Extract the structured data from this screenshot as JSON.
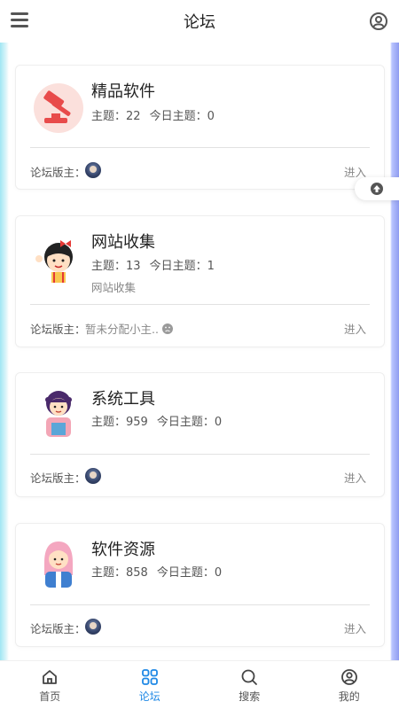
{
  "header": {
    "title": "论坛"
  },
  "forums": [
    {
      "name": "精品软件",
      "topics_label": "主题：",
      "topics": "22",
      "today_label": "今日主题：",
      "today": "0",
      "desc": "",
      "mod_label": "论坛版主：",
      "mod_none": "",
      "enter": "进入",
      "icon": "gavel-icon"
    },
    {
      "name": "网站收集",
      "topics_label": "主题：",
      "topics": "13",
      "today_label": "今日主题：",
      "today": "1",
      "desc": "网站收集",
      "mod_label": "论坛版主：",
      "mod_none": "暂未分配小主..",
      "enter": "进入",
      "icon": "girl-cartoon-icon"
    },
    {
      "name": "系统工具",
      "topics_label": "主题：",
      "topics": "959",
      "today_label": "今日主题：",
      "today": "0",
      "desc": "",
      "mod_label": "论坛版主：",
      "mod_none": "",
      "enter": "进入",
      "icon": "woman-overalls-icon"
    },
    {
      "name": "软件资源",
      "topics_label": "主题：",
      "topics": "858",
      "today_label": "今日主题：",
      "today": "0",
      "desc": "",
      "mod_label": "论坛版主：",
      "mod_none": "",
      "enter": "进入",
      "icon": "pink-hair-woman-icon"
    }
  ],
  "nav": [
    {
      "label": "首页",
      "icon": "home-icon",
      "active": false
    },
    {
      "label": "论坛",
      "icon": "grid-icon",
      "active": true
    },
    {
      "label": "搜索",
      "icon": "search-icon",
      "active": false
    },
    {
      "label": "我的",
      "icon": "user-circle-icon",
      "active": false
    }
  ],
  "colors": {
    "accent": "#1e88e5",
    "text": "#222222",
    "muted": "#888888"
  }
}
